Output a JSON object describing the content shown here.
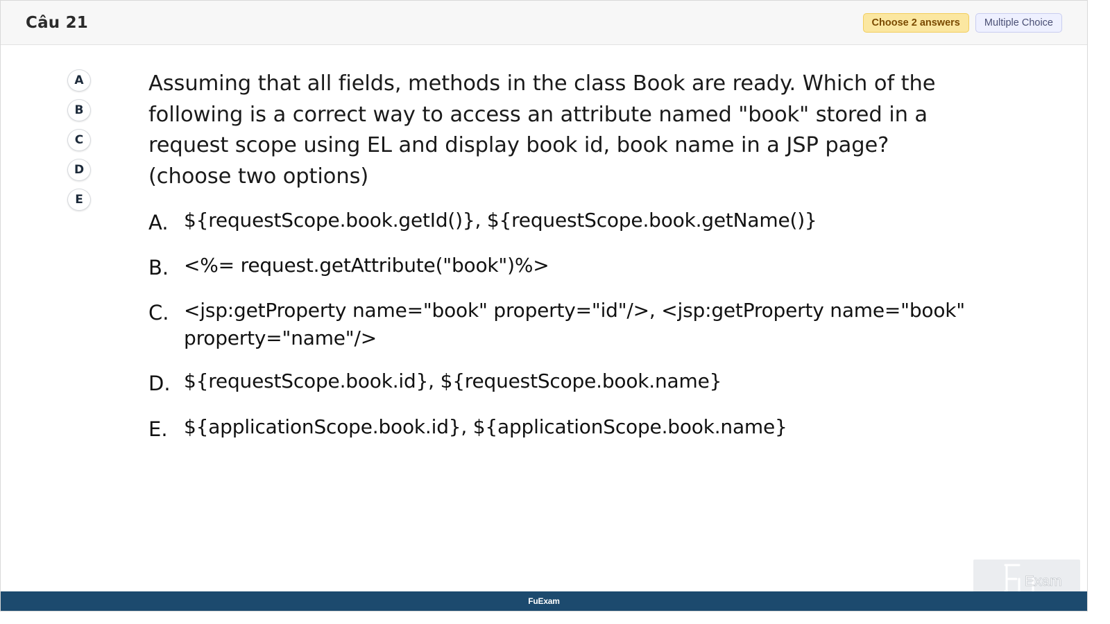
{
  "header": {
    "title": "Câu 21",
    "badge_choose": "Choose 2 answers",
    "badge_type": "Multiple Choice"
  },
  "answer_nav": [
    "A",
    "B",
    "C",
    "D",
    "E"
  ],
  "question": {
    "text": "Assuming that all fields, methods in the class Book are ready. Which of the following is a correct way to access an attribute named \"book\" stored in a request scope using EL and display book id, book name in a JSP page? (choose two options)"
  },
  "options": [
    {
      "letter": "A.",
      "text": "${requestScope.book.getId()}, ${requestScope.book.getName()}"
    },
    {
      "letter": "B.",
      "text": "<%= request.getAttribute(\"book\")%>"
    },
    {
      "letter": "C.",
      "text": "<jsp:getProperty name=\"book\" property=\"id\"/>, <jsp:getProperty name=\"book\" property=\"name\"/>"
    },
    {
      "letter": "D.",
      "text": "${requestScope.book.id}, ${requestScope.book.name}"
    },
    {
      "letter": "E.",
      "text": "${applicationScope.book.id}, ${applicationScope.book.name}"
    }
  ],
  "footer": {
    "brand": "FuExam"
  },
  "watermark": {
    "logo": "FU Exam",
    "icon": "fuexam-logo-icon"
  },
  "colors": {
    "footer_bg": "#1c4a6e",
    "badge_choose_bg": "#fbe7a1",
    "badge_type_bg": "#eef0ff"
  }
}
